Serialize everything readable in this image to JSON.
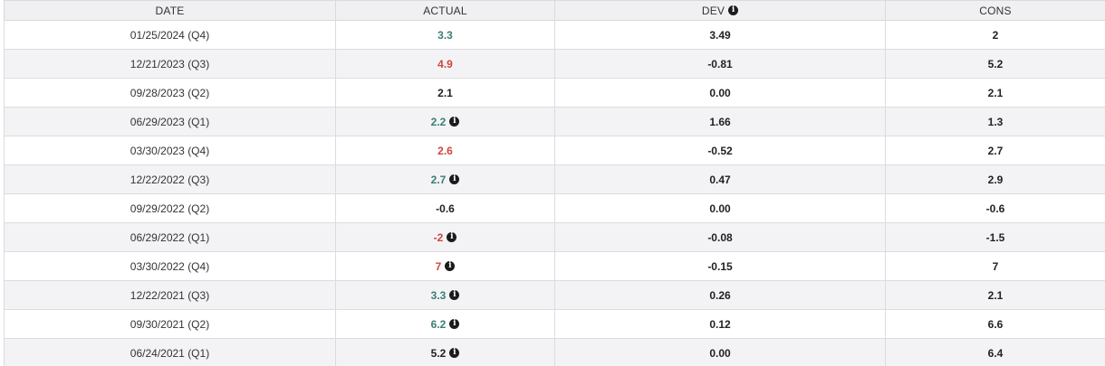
{
  "colors": {
    "up": "#3b7d73",
    "down": "#d0453a",
    "neutral": "#1f1f1f",
    "header_bg": "#f0f0f2",
    "row_alt_bg": "#f3f3f6"
  },
  "header": {
    "date": "DATE",
    "actual": "ACTUAL",
    "dev": "DEV",
    "dev_icon": "info-icon",
    "cons": "CONS"
  },
  "rows": [
    {
      "date": "01/25/2024 (Q4)",
      "actual": "3.3",
      "actual_status": "up",
      "actual_info": false,
      "dev": "3.49",
      "cons": "2"
    },
    {
      "date": "12/21/2023 (Q3)",
      "actual": "4.9",
      "actual_status": "down",
      "actual_info": false,
      "dev": "-0.81",
      "cons": "5.2"
    },
    {
      "date": "09/28/2023 (Q2)",
      "actual": "2.1",
      "actual_status": "neutral",
      "actual_info": false,
      "dev": "0.00",
      "cons": "2.1"
    },
    {
      "date": "06/29/2023 (Q1)",
      "actual": "2.2",
      "actual_status": "up",
      "actual_info": true,
      "dev": "1.66",
      "cons": "1.3"
    },
    {
      "date": "03/30/2023 (Q4)",
      "actual": "2.6",
      "actual_status": "down",
      "actual_info": false,
      "dev": "-0.52",
      "cons": "2.7"
    },
    {
      "date": "12/22/2022 (Q3)",
      "actual": "2.7",
      "actual_status": "up",
      "actual_info": true,
      "dev": "0.47",
      "cons": "2.9"
    },
    {
      "date": "09/29/2022 (Q2)",
      "actual": "-0.6",
      "actual_status": "neutral",
      "actual_info": false,
      "dev": "0.00",
      "cons": "-0.6"
    },
    {
      "date": "06/29/2022 (Q1)",
      "actual": "-2",
      "actual_status": "down",
      "actual_info": true,
      "dev": "-0.08",
      "cons": "-1.5"
    },
    {
      "date": "03/30/2022 (Q4)",
      "actual": "7",
      "actual_status": "down",
      "actual_info": true,
      "dev": "-0.15",
      "cons": "7"
    },
    {
      "date": "12/22/2021 (Q3)",
      "actual": "3.3",
      "actual_status": "up",
      "actual_info": true,
      "dev": "0.26",
      "cons": "2.1"
    },
    {
      "date": "09/30/2021 (Q2)",
      "actual": "6.2",
      "actual_status": "up",
      "actual_info": true,
      "dev": "0.12",
      "cons": "6.6"
    },
    {
      "date": "06/24/2021 (Q1)",
      "actual": "5.2",
      "actual_status": "neutral",
      "actual_info": true,
      "dev": "0.00",
      "cons": "6.4"
    }
  ]
}
